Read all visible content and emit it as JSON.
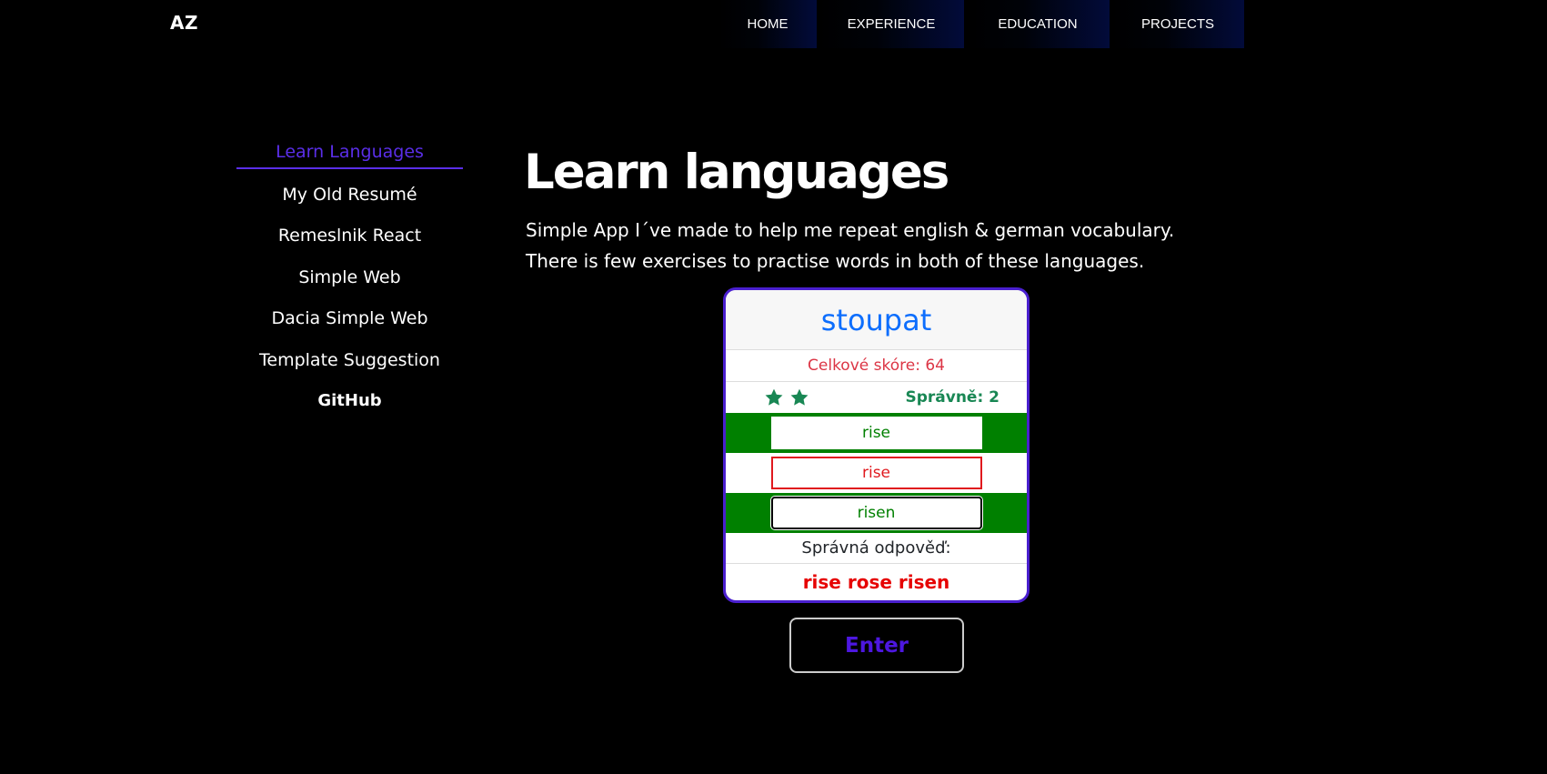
{
  "header": {
    "logo": "AZ",
    "nav": [
      "HOME",
      "EXPERIENCE",
      "EDUCATION",
      "PROJECTS"
    ]
  },
  "sidebar": {
    "items": [
      {
        "label": "Learn Languages",
        "active": true
      },
      {
        "label": "My Old Resumé",
        "active": false
      },
      {
        "label": "Remeslnik React",
        "active": false
      },
      {
        "label": "Simple Web",
        "active": false
      },
      {
        "label": "Dacia Simple Web",
        "active": false
      },
      {
        "label": "Template Suggestion",
        "active": false
      },
      {
        "label": "GitHub",
        "active": false
      }
    ]
  },
  "main": {
    "title": "Learn languages",
    "description": [
      "Simple App I´ve made to help me repeat english & german vocabulary.",
      "There is few exercises to practise words in both of these languages."
    ]
  },
  "quiz": {
    "word": "stoupat",
    "total_score": "Celkové skóre: 64",
    "stars": 2,
    "correct": "Správně: 2",
    "answers": [
      {
        "value": "rise",
        "state": "correct"
      },
      {
        "value": "rise",
        "state": "wrong"
      },
      {
        "value": "risen",
        "state": "correct"
      }
    ],
    "answer_label": "Správná odpověď:",
    "answer_text": "rise rose risen",
    "enter_label": "Enter"
  },
  "colors": {
    "accent": "#4a1fcf",
    "correct_bg": "#008000",
    "wrong": "#e0191e",
    "word": "#0d6efd",
    "score": "#dc3545",
    "star": "#198754"
  }
}
